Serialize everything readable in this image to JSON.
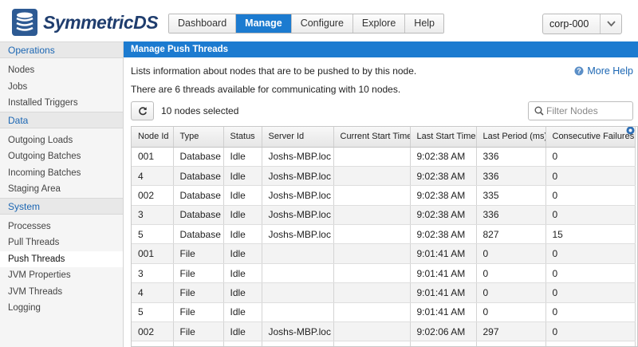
{
  "app": {
    "logo_text": "SymmetricDS"
  },
  "nav": {
    "items": [
      "Dashboard",
      "Manage",
      "Configure",
      "Explore",
      "Help"
    ],
    "active": "Manage"
  },
  "node_selector": {
    "value": "corp-000"
  },
  "sidebar": {
    "sections": [
      {
        "title": "Operations",
        "items": [
          "Nodes",
          "Jobs",
          "Installed Triggers"
        ]
      },
      {
        "title": "Data",
        "items": [
          "Outgoing Loads",
          "Outgoing Batches",
          "Incoming Batches",
          "Staging Area"
        ]
      },
      {
        "title": "System",
        "items": [
          "Processes",
          "Pull Threads",
          "Push Threads",
          "JVM Properties",
          "JVM Threads",
          "Logging"
        ]
      }
    ],
    "active": "Push Threads"
  },
  "panel": {
    "title": "Manage Push Threads",
    "description": "Lists information about nodes that are to be pushed to by this node.",
    "threads_info": "There are 6 threads available for communicating with 10 nodes.",
    "help_label": "More Help",
    "selected_count": "10 nodes selected",
    "filter_placeholder": "Filter Nodes"
  },
  "table": {
    "columns": [
      "Node Id",
      "Type",
      "Status",
      "Server Id",
      "Current Start Time",
      "Last Start Time",
      "Last Period (ms)",
      "Consecutive Failures"
    ],
    "rows": [
      [
        "001",
        "Database",
        "Idle",
        "Joshs-MBP.loc",
        "",
        "9:02:38 AM",
        "336",
        "0"
      ],
      [
        "4",
        "Database",
        "Idle",
        "Joshs-MBP.loc",
        "",
        "9:02:38 AM",
        "336",
        "0"
      ],
      [
        "002",
        "Database",
        "Idle",
        "Joshs-MBP.loc",
        "",
        "9:02:38 AM",
        "335",
        "0"
      ],
      [
        "3",
        "Database",
        "Idle",
        "Joshs-MBP.loc",
        "",
        "9:02:38 AM",
        "336",
        "0"
      ],
      [
        "5",
        "Database",
        "Idle",
        "Joshs-MBP.loc",
        "",
        "9:02:38 AM",
        "827",
        "15"
      ],
      [
        "001",
        "File",
        "Idle",
        "",
        "",
        "9:01:41 AM",
        "0",
        "0"
      ],
      [
        "3",
        "File",
        "Idle",
        "",
        "",
        "9:01:41 AM",
        "0",
        "0"
      ],
      [
        "4",
        "File",
        "Idle",
        "",
        "",
        "9:01:41 AM",
        "0",
        "0"
      ],
      [
        "5",
        "File",
        "Idle",
        "",
        "",
        "9:01:41 AM",
        "0",
        "0"
      ],
      [
        "002",
        "File",
        "Idle",
        "Joshs-MBP.loc",
        "",
        "9:02:06 AM",
        "297",
        "0"
      ],
      [
        "",
        "",
        "",
        "",
        "",
        "",
        "",
        ""
      ]
    ]
  },
  "colors": {
    "accent": "#1c7bd0",
    "link": "#1b66b3",
    "logo": "#1f3d6e"
  }
}
